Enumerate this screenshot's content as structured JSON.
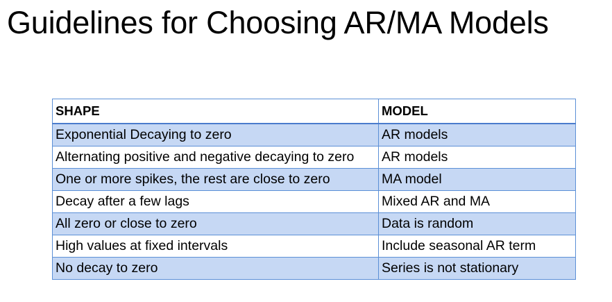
{
  "title": "Guidelines for Choosing AR/MA Models",
  "table": {
    "headers": [
      "SHAPE",
      "MODEL"
    ],
    "rows": [
      [
        "Exponential Decaying to zero",
        "AR models"
      ],
      [
        "Alternating positive and negative decaying to zero",
        "AR models"
      ],
      [
        "One or more spikes, the rest are close to zero",
        "MA model"
      ],
      [
        "Decay after a few lags",
        "Mixed AR and MA"
      ],
      [
        "All zero or close to zero",
        "Data is random"
      ],
      [
        "High values at fixed intervals",
        "Include seasonal AR term"
      ],
      [
        "No decay to zero",
        "Series is not stationary"
      ]
    ]
  },
  "colors": {
    "row_band": "#c6d8f4",
    "border": "#5b8fd6",
    "header_rule": "#4a7ccc"
  }
}
